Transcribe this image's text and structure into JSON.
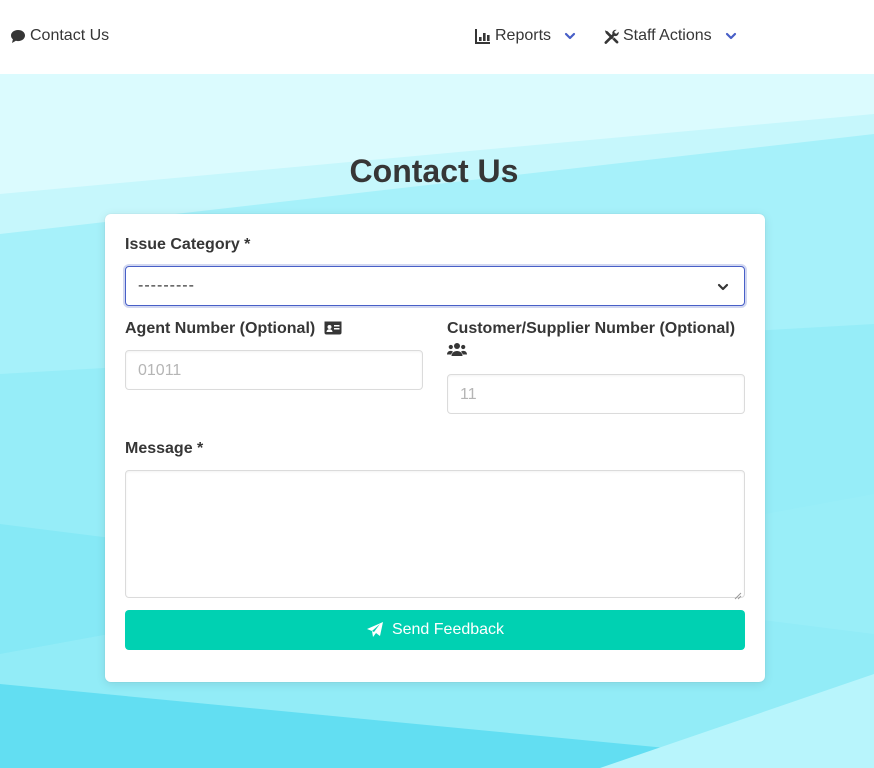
{
  "nav": {
    "contact": "Contact Us",
    "reports": "Reports",
    "staff_actions": "Staff Actions"
  },
  "page": {
    "title": "Contact Us"
  },
  "form": {
    "issue_category_label": "Issue Category *",
    "issue_category_value": "---------",
    "agent_label": "Agent Number (Optional)",
    "agent_placeholder": "01011",
    "customer_label": "Customer/Supplier Number (Optional)",
    "customer_placeholder": "11",
    "message_label": "Message *",
    "submit_label": "Send Feedback"
  },
  "icons": {
    "contact": "comment-icon",
    "reports": "chart-bar-icon",
    "staff": "tools-icon",
    "agent": "id-card-icon",
    "customer": "users-icon",
    "submit": "paper-plane-icon",
    "dropdown": "chevron-down-icon"
  },
  "colors": {
    "primary": "#485fc7",
    "accent": "#00d1b2",
    "text": "#363636",
    "placeholder": "#b5b5b5",
    "background": "#b3f4fb"
  }
}
